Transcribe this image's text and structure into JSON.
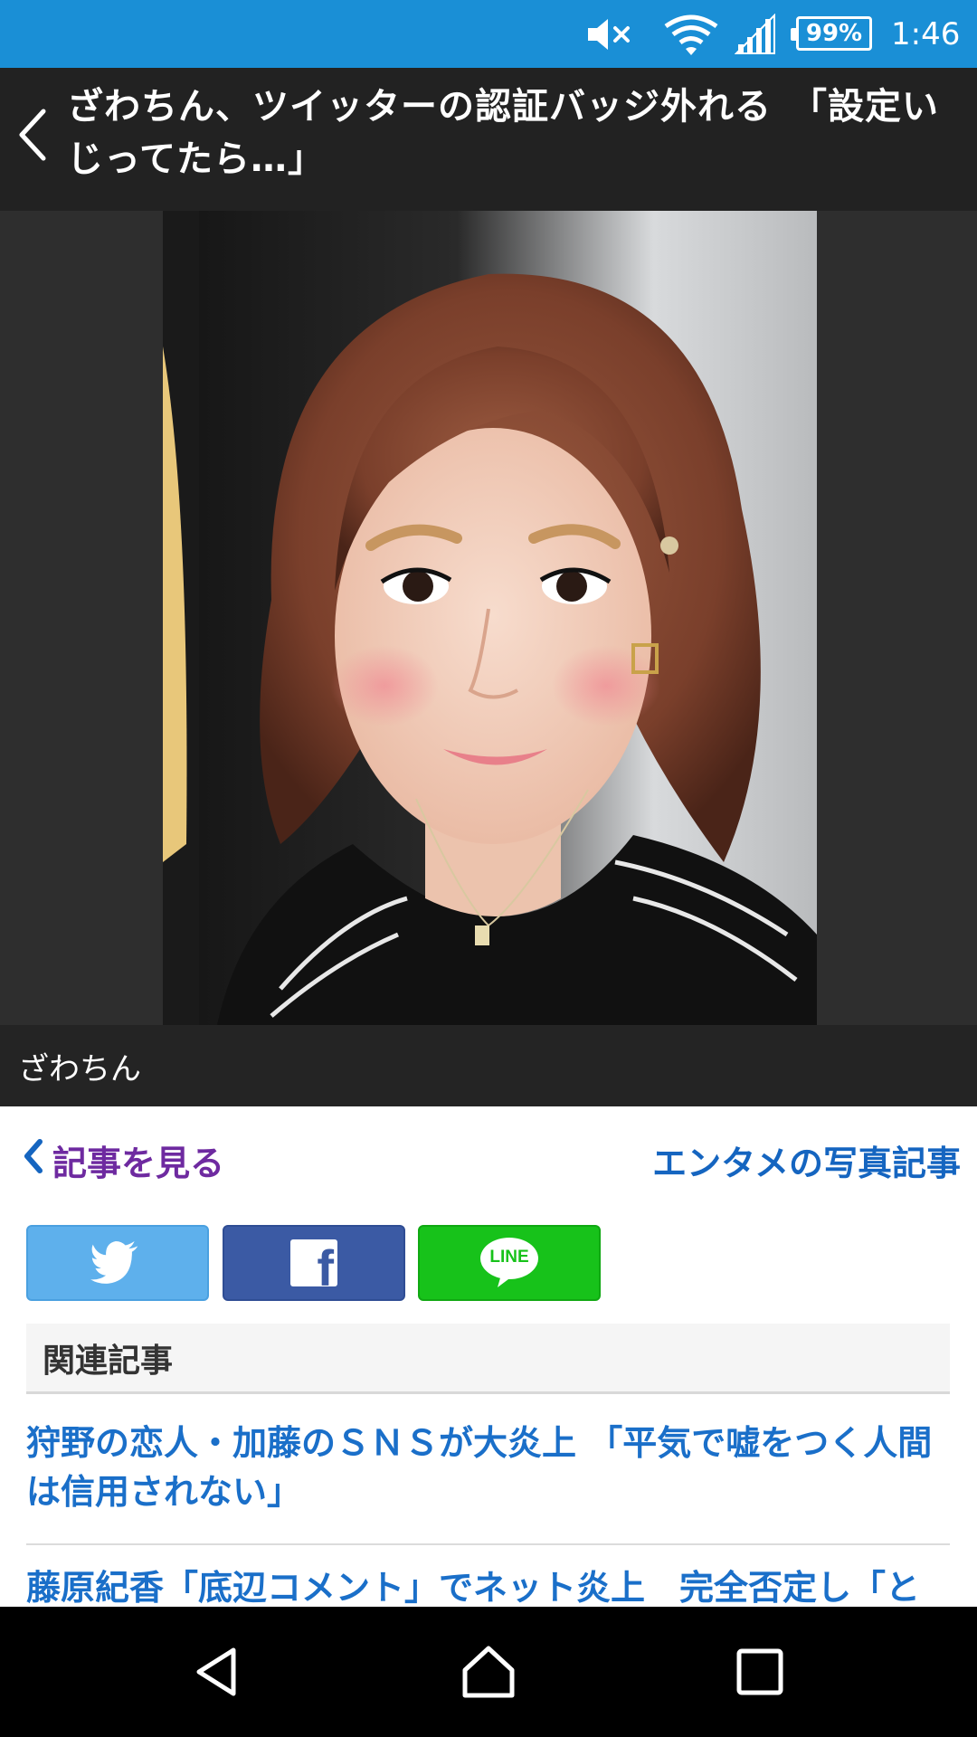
{
  "status_bar": {
    "battery_percent": "99%",
    "time": "1:46",
    "icons": [
      "volume-mute-icon",
      "wifi-icon",
      "signal-icon",
      "battery-icon"
    ]
  },
  "header": {
    "title": "ざわちん、ツイッターの認証バッジ外れる　「設定いじってたら…」"
  },
  "photo": {
    "caption": "ざわちん"
  },
  "nav": {
    "back_label": "記事を見る",
    "category_label": "エンタメの写真記事"
  },
  "share": {
    "line_label": "LINE",
    "facebook_label": "f",
    "colors": {
      "twitter": "#5eb0ec",
      "facebook": "#3b5aa4",
      "line": "#17c21a"
    }
  },
  "related": {
    "heading": "関連記事",
    "articles": [
      {
        "title": "狩野の恋人・加藤のＳＮＳが大炎上 「平気で嘘をつく人間は信用されない」"
      },
      {
        "title": "藤原紀香「底辺コメント」でネット炎上　完全否定し「と"
      }
    ]
  },
  "colors": {
    "status_bar": "#1a8fd6",
    "link": "#1a6fc9",
    "visited": "#6e2aa0"
  }
}
